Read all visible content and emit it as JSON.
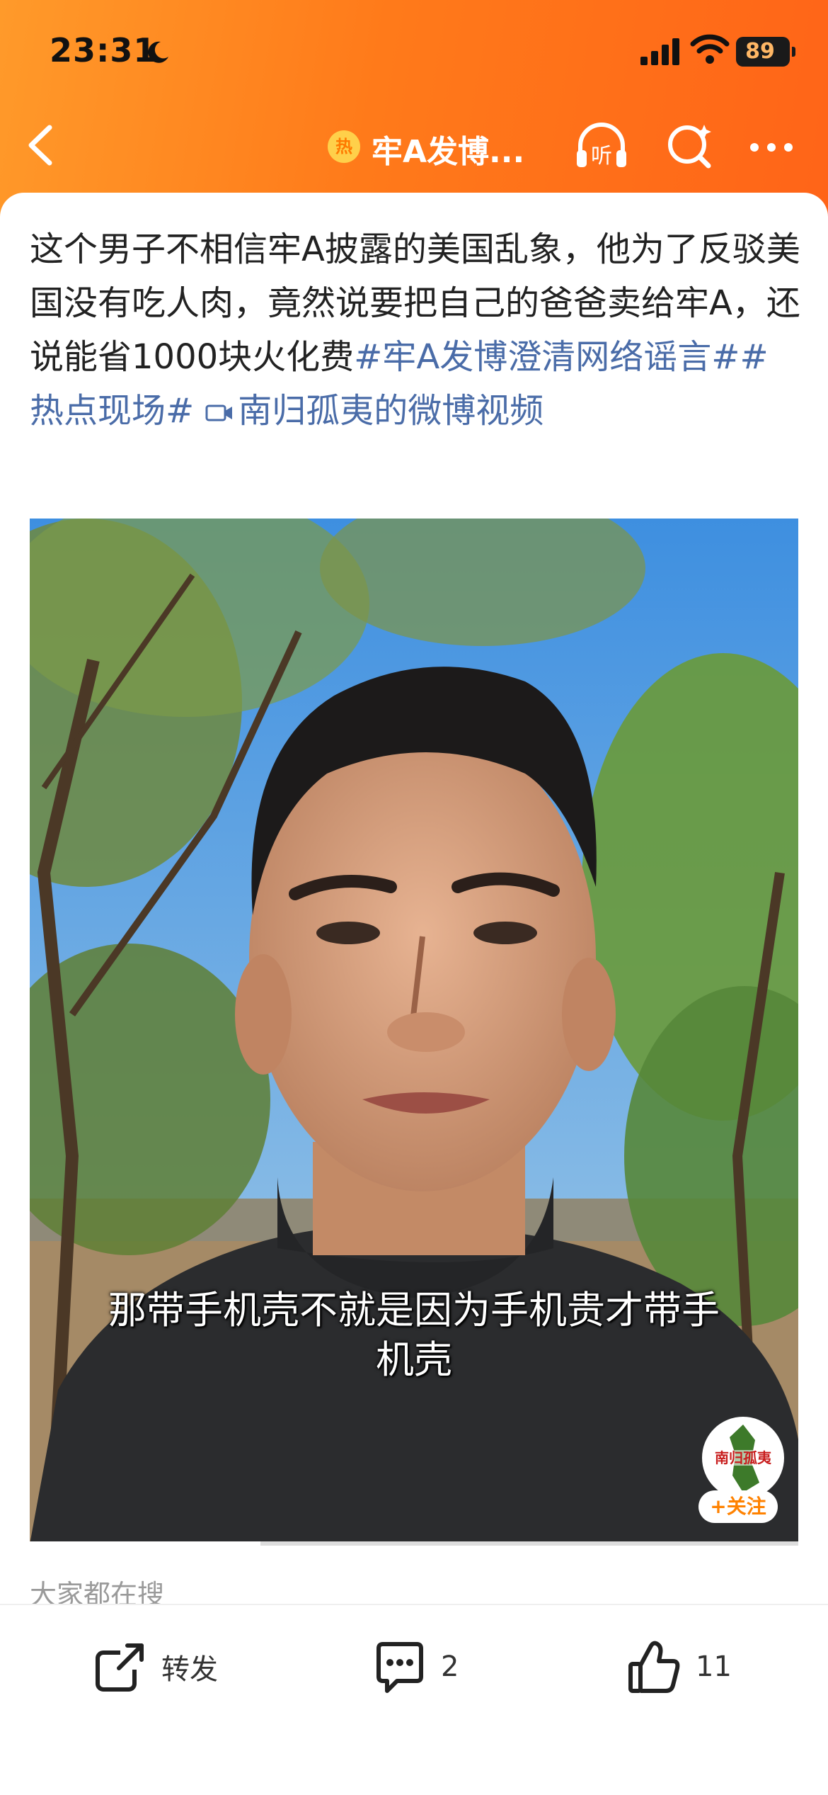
{
  "status_bar": {
    "time": "23:31",
    "battery": "89"
  },
  "nav": {
    "hot_badge": "热",
    "title": "牢A发博..."
  },
  "post": {
    "text": "这个男子不相信牢A披露的美国乱象，他为了反驳美国没有吃人肉，竟然说要把自己的爸爸卖给牢A，还说能省1000块火化费",
    "tags": [
      "#牢A发博澄清网络谣言#",
      "#热点现场#"
    ],
    "video_link": "南归孤夷的微博视频"
  },
  "video": {
    "subtitle_line1": "那带手机壳不就是因为手机贵才带手",
    "subtitle_line2": "机壳",
    "avatar_text": "南归孤夷",
    "follow_label": "+关注",
    "progress": 0.3
  },
  "search_hint": "大家都在搜",
  "actions": {
    "forward_label": "转发",
    "comment_count": "2",
    "like_count": "11"
  },
  "colors": {
    "orange": "#ff7a1a",
    "link": "#4a6ca8"
  }
}
